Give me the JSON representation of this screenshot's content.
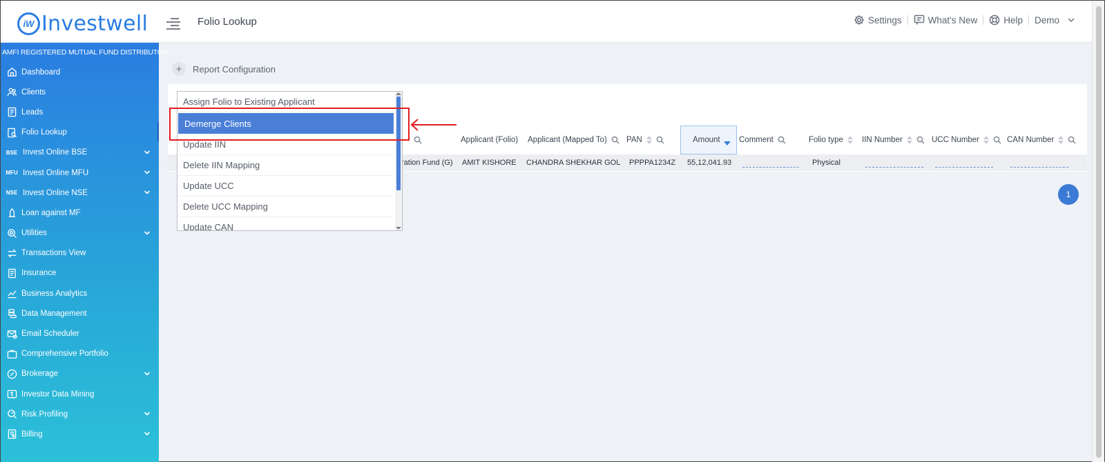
{
  "app": {
    "logo_mark": "iW",
    "logo_text": "Investwell",
    "page_title": "Folio Lookup"
  },
  "topnav": {
    "settings": "Settings",
    "whats_new": "What's New",
    "help": "Help",
    "user": "Demo"
  },
  "sidebar": {
    "distributor": "AMFI REGISTERED MUTUAL FUND DISTRIBUTOR",
    "items": [
      {
        "label": "Dashboard",
        "icon": "home-icon",
        "expandable": false
      },
      {
        "label": "Clients",
        "icon": "users-icon",
        "expandable": false
      },
      {
        "label": "Leads",
        "icon": "leads-icon",
        "expandable": false
      },
      {
        "label": "Folio Lookup",
        "icon": "folio-icon",
        "expandable": false
      },
      {
        "label": "Invest Online BSE",
        "icon": "bse-icon",
        "badge": "BSE",
        "expandable": true
      },
      {
        "label": "Invest Online MFU",
        "icon": "mfu-icon",
        "badge": "MFU",
        "expandable": true
      },
      {
        "label": "Invest Online NSE",
        "icon": "nse-icon",
        "badge": "NSE",
        "expandable": true
      },
      {
        "label": "Loan against MF",
        "icon": "loan-icon",
        "expandable": false
      },
      {
        "label": "Utilities",
        "icon": "utilities-icon",
        "expandable": true
      },
      {
        "label": "Transactions View",
        "icon": "transactions-icon",
        "expandable": false
      },
      {
        "label": "Insurance",
        "icon": "insurance-icon",
        "expandable": false
      },
      {
        "label": "Business Analytics",
        "icon": "analytics-icon",
        "expandable": false
      },
      {
        "label": "Data Management",
        "icon": "data-icon",
        "expandable": false
      },
      {
        "label": "Email Scheduler",
        "icon": "email-icon",
        "expandable": false
      },
      {
        "label": "Comprehensive Portfolio",
        "icon": "portfolio-icon",
        "expandable": false
      },
      {
        "label": "Brokerage",
        "icon": "brokerage-icon",
        "expandable": true
      },
      {
        "label": "Investor Data Mining",
        "icon": "mining-icon",
        "expandable": false
      },
      {
        "label": "Risk Profiling",
        "icon": "risk-icon",
        "expandable": true
      },
      {
        "label": "Billing",
        "icon": "billing-icon",
        "expandable": true
      }
    ]
  },
  "main": {
    "report_config": "Report Configuration",
    "columns": {
      "applicant_folio": "Applicant (Folio)",
      "applicant_mapped": "Applicant (Mapped To)",
      "pan": "PAN",
      "amount": "Amount",
      "comment": "Comment",
      "folio_type": "Folio type",
      "iin": "IIN Number",
      "ucc": "UCC Number",
      "can": "CAN Number"
    },
    "row": {
      "scheme_partial": "ration Fund (G)",
      "applicant_folio": "AMIT KISHORE",
      "applicant_mapped": "CHANDRA SHEKHAR GOL",
      "pan": "PPPPA1234Z",
      "amount": "55,12,041.93",
      "folio_type": "Physical"
    },
    "pagination": {
      "current_page": "1"
    }
  },
  "dropdown": {
    "options": [
      "Assign Folio to Existing Applicant",
      "Demerge Clients",
      "Update IIN",
      "Delete IIN Mapping",
      "Update UCC",
      "Delete UCC Mapping",
      "Update CAN"
    ],
    "selected": "Demerge Clients"
  },
  "colors": {
    "brand": "#2a7de1",
    "selected": "#4a7fd8",
    "annotation": "#e11d1d"
  }
}
